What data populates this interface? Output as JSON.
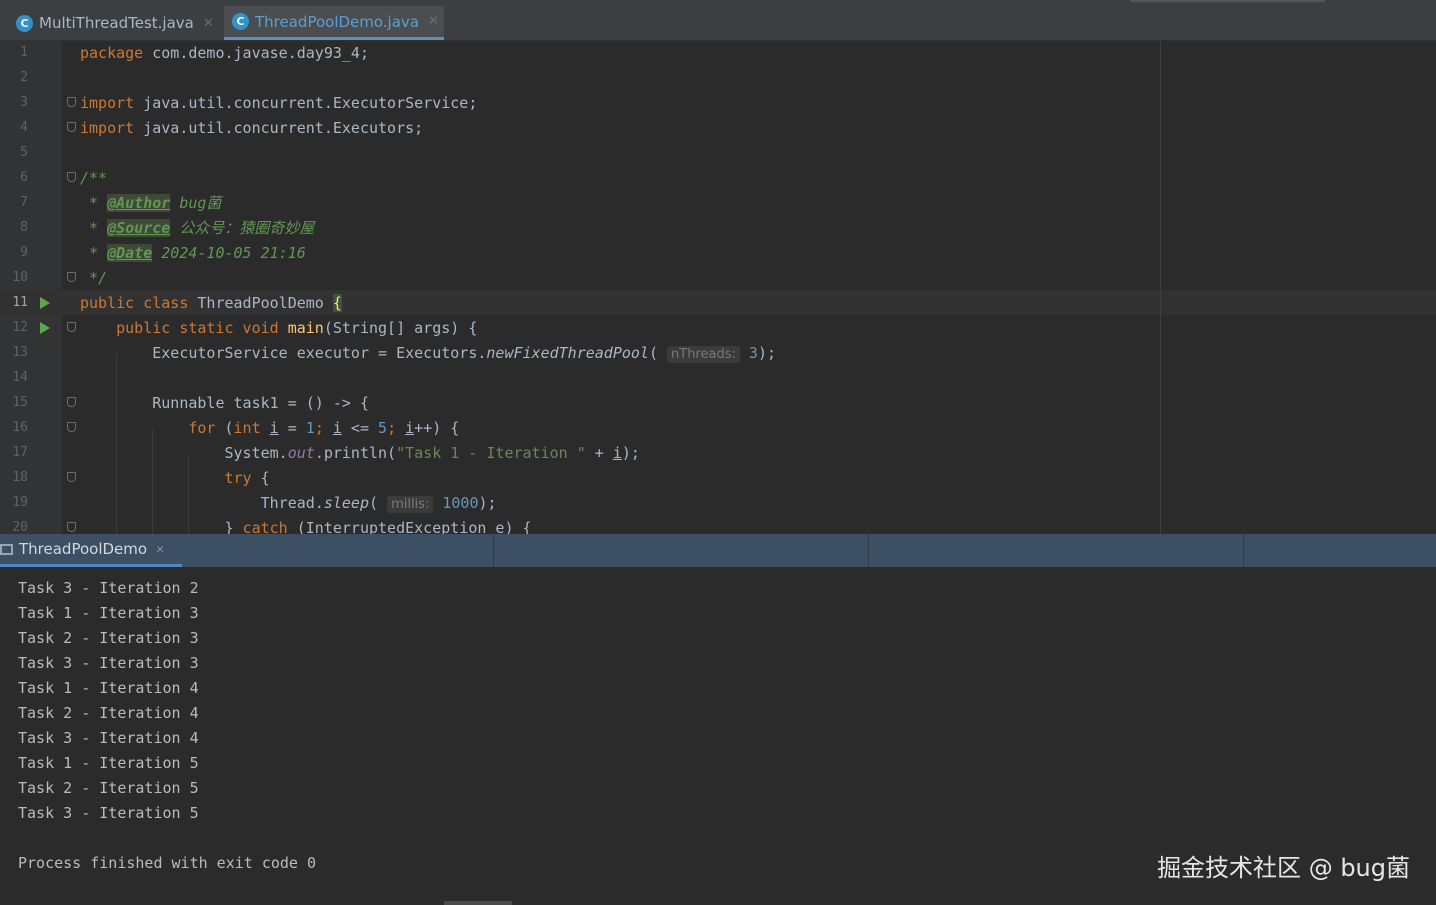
{
  "tabs": [
    {
      "label": "MultiThreadTest.java",
      "icon": "java-class-icon"
    },
    {
      "label": "ThreadPoolDemo.java",
      "icon": "java-class-icon",
      "active": true
    }
  ],
  "editor": {
    "line_numbers": [
      "1",
      "2",
      "3",
      "4",
      "5",
      "6",
      "7",
      "8",
      "9",
      "10",
      "11",
      "12",
      "13",
      "14",
      "15",
      "16",
      "17",
      "18",
      "19",
      "20"
    ],
    "code": {
      "l1_kw": "package",
      "l1_rest": " com.demo.javase.day93_4;",
      "l3_kw": "import",
      "l3_rest": " java.util.concurrent.ExecutorService;",
      "l4_kw": "import",
      "l4_rest": " java.util.concurrent.Executors;",
      "l6": "/**",
      "l7_star": " * ",
      "l7_tag": "@Author",
      "l7_text": " bug菌",
      "l8_star": " * ",
      "l8_tag": "@Source",
      "l8_text": " 公众号：猿圈奇妙屋",
      "l9_star": " * ",
      "l9_tag": "@Date",
      "l9_text": " 2024-10-05 21:16",
      "l10": " */",
      "l11_kw": "public class",
      "l11_name": " ThreadPoolDemo ",
      "l11_brace": "{",
      "l12_kw": "    public static void",
      "l12_method": " main",
      "l12_rest": "(String[] args) {",
      "l13_a": "        ExecutorService executor = Executors.",
      "l13_method": "newFixedThreadPool",
      "l13_b": "( ",
      "l13_hint": "nThreads:",
      "l13_num": " 3",
      "l13_c": ");",
      "l15": "        Runnable task1 = () -> {",
      "l16_kw": "            for",
      "l16_a": " (",
      "l16_int": "int",
      "l16_b": " ",
      "l16_i1": "i",
      "l16_c": " = ",
      "l16_n1": "1",
      "l16_d": "; ",
      "l16_i2": "i",
      "l16_e": " <= ",
      "l16_n2": "5",
      "l16_f": "; ",
      "l16_i3": "i",
      "l16_g": "++) {",
      "l17_a": "                System.",
      "l17_out": "out",
      "l17_b": ".println(",
      "l17_str": "\"Task 1 - Iteration \"",
      "l17_c": " + ",
      "l17_i": "i",
      "l17_d": ");",
      "l18_kw": "                try",
      "l18_rest": " {",
      "l19_a": "                    Thread.",
      "l19_method": "sleep",
      "l19_b": "( ",
      "l19_hint": "millis:",
      "l19_num": " 1000",
      "l19_c": ");",
      "l20_a": "                } ",
      "l20_kw": "catch",
      "l20_b": " (InterruptedException e) {"
    }
  },
  "run_panel": {
    "tab_label": "ThreadPoolDemo",
    "output": [
      "Task 3 - Iteration 2",
      "Task 1 - Iteration 3",
      "Task 2 - Iteration 3",
      "Task 3 - Iteration 3",
      "Task 1 - Iteration 4",
      "Task 2 - Iteration 4",
      "Task 3 - Iteration 4",
      "Task 1 - Iteration 5",
      "Task 2 - Iteration 5",
      "Task 3 - Iteration 5"
    ],
    "exit_message": "Process finished with exit code 0"
  },
  "watermark": "掘金技术社区 @ bug菌",
  "colors": {
    "keyword": "#cc7832",
    "string": "#6a8759",
    "number": "#6897bb",
    "javadoc": "#629755",
    "method": "#ffc66d",
    "run_arrow": "#5fa44e",
    "run_bar": "#3c4f63"
  }
}
